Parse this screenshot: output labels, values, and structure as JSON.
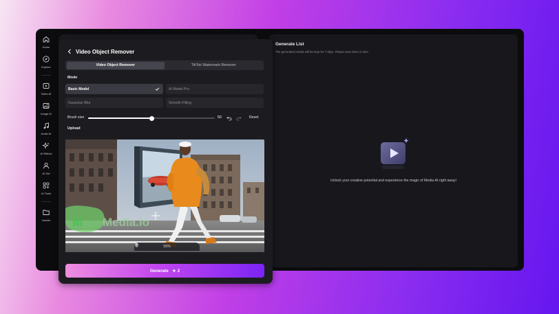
{
  "sidebar": {
    "items": [
      {
        "icon": "home-icon",
        "label": "Home"
      },
      {
        "icon": "compass-icon",
        "label": "Explore"
      },
      {
        "icon": "video-icon",
        "label": "Video AI"
      },
      {
        "icon": "image-icon",
        "label": "Image AI"
      },
      {
        "icon": "music-note-icon",
        "label": "Audio AI"
      },
      {
        "icon": "sparkles-icon",
        "label": "AI Effects"
      },
      {
        "icon": "user-icon",
        "label": "AI Girl"
      },
      {
        "icon": "tools-icon",
        "label": "AI Tools"
      },
      {
        "icon": "folder-icon",
        "label": "Assets"
      }
    ]
  },
  "tool": {
    "title": "Video Object Remover",
    "tabs": [
      {
        "label": "Video Object Remover",
        "active": true
      },
      {
        "label": "TikTok Watermark Remover",
        "active": false
      }
    ],
    "mode_label": "Mode",
    "modes": [
      {
        "label": "Basic Model",
        "selected": true
      },
      {
        "label": "AI Model Pro",
        "selected": false
      },
      {
        "label": "Gaussian Blur",
        "selected": false
      },
      {
        "label": "Smooth Filling",
        "selected": false
      }
    ],
    "brush": {
      "label": "Brush size",
      "value": 50,
      "min": 0,
      "max": 100,
      "reset": "Reset"
    },
    "upload_label": "Upload",
    "preview": {
      "watermark": "Media.io",
      "zoom": "55%"
    },
    "generate": {
      "label": "Generate",
      "credits": "2"
    }
  },
  "generate_list": {
    "title": "Generate List",
    "subtitle": "The generated results will be kept for 7 days. Please save them in time.",
    "empty_message": "Unlock your creative potential and experience the magic of Media.AI right away!"
  },
  "colors": {
    "accent_start": "#ef8fe0",
    "accent_end": "#7a24f5",
    "panel": "#1c1c20",
    "app_bg": "#0c0c0f",
    "jacket": "#e98a1c"
  }
}
